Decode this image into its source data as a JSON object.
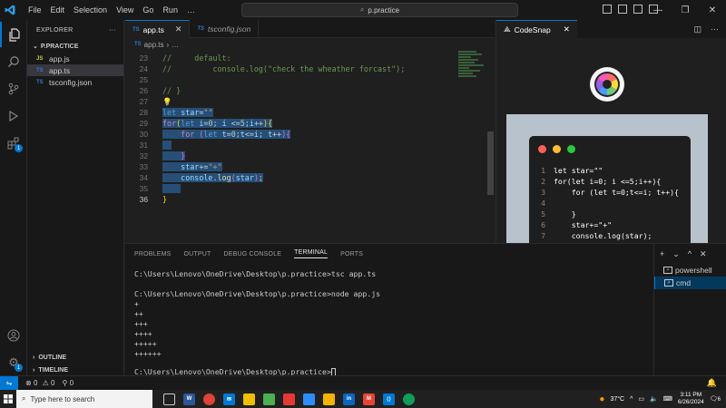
{
  "titlebar": {
    "menu": [
      "File",
      "Edit",
      "Selection",
      "View",
      "Go",
      "Run",
      "…"
    ],
    "search": "p.practice"
  },
  "explorer": {
    "header": "EXPLORER",
    "folder": "P.PRACTICE",
    "files": [
      {
        "name": "app.js",
        "type": "JS"
      },
      {
        "name": "app.ts",
        "type": "TS"
      },
      {
        "name": "tsconfig.json",
        "type": "TS"
      }
    ],
    "outline": "OUTLINE",
    "timeline": "TIMELINE"
  },
  "editor": {
    "tabs": [
      {
        "label": "app.ts",
        "type": "TS",
        "active": true
      },
      {
        "label": "tsconfig.json",
        "type": "TS",
        "active": false
      }
    ],
    "breadcrumb_file": "app.ts",
    "breadcrumb_more": "…",
    "line_numbers": [
      "23",
      "24",
      "25",
      "26",
      "27",
      "28",
      "29",
      "30",
      "31",
      "32",
      "33",
      "34",
      "35",
      "36"
    ],
    "current_line": "36"
  },
  "codesnap": {
    "title": "CodeSnap",
    "line_numbers": [
      "1",
      "2",
      "3",
      "4",
      "5",
      "6",
      "7"
    ],
    "code": [
      "let star=\"\"",
      "for(let i=0; i <=5;i++){",
      "    for (let t=0;t<=i; t++){",
      "",
      "    }",
      "    star+=\"+\"",
      "    console.log(star);"
    ]
  },
  "panel": {
    "tabs": [
      "PROBLEMS",
      "OUTPUT",
      "DEBUG CONSOLE",
      "TERMINAL",
      "PORTS"
    ],
    "active_tab": "TERMINAL",
    "terminal_lines": [
      "C:\\Users\\Lenovo\\OneDrive\\Desktop\\p.practice>tsc app.ts",
      "",
      "C:\\Users\\Lenovo\\OneDrive\\Desktop\\p.practice>node app.js",
      "+",
      "++",
      "+++",
      "++++",
      "+++++",
      "++++++",
      "",
      "C:\\Users\\Lenovo\\OneDrive\\Desktop\\p.practice>"
    ],
    "terminals": [
      "powershell",
      "cmd"
    ]
  },
  "statusbar": {
    "errors": "0",
    "warnings": "0",
    "ports": "0"
  },
  "taskbar": {
    "search_placeholder": "Type here to search",
    "temperature": "37°C",
    "time": "3:11 PM",
    "date": "6/26/2024",
    "notification_count": "6"
  },
  "colors": {
    "accent": "#0078d4",
    "background": "#1f1f1f",
    "sidebar": "#181818"
  }
}
